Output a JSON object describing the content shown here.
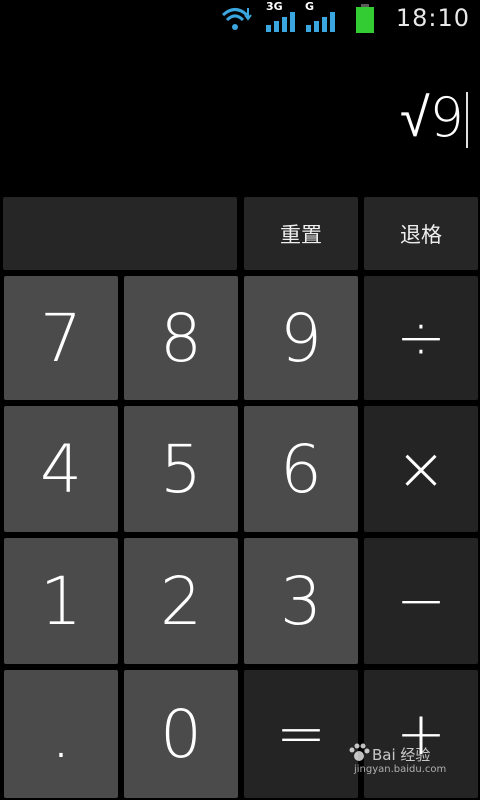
{
  "status_bar": {
    "time": "18:10",
    "network_3g_label": "3G",
    "network_g_label": "G",
    "icons": [
      "wifi-icon",
      "signal-3g-icon",
      "signal-g-icon",
      "battery-icon"
    ],
    "battery_color": "#33cc33"
  },
  "display": {
    "expression": "√9"
  },
  "keys": {
    "top_row": {
      "reset": "重置",
      "backspace": "退格"
    },
    "digits": {
      "seven": "7",
      "eight": "8",
      "nine": "9",
      "four": "4",
      "five": "5",
      "six": "6",
      "one": "1",
      "two": "2",
      "three": "3",
      "dot": ".",
      "zero": "0"
    },
    "operators": {
      "divide": "÷",
      "multiply": "×",
      "minus": "−",
      "plus": "+",
      "equals": "="
    }
  },
  "watermark": {
    "brand": "Bai 经验",
    "url": "jingyan.baidu.com"
  },
  "colors": {
    "key_light": "#4b4b4b",
    "key_dark": "#242424",
    "background": "#000000",
    "status_icon_blue": "#3ba7e0"
  }
}
